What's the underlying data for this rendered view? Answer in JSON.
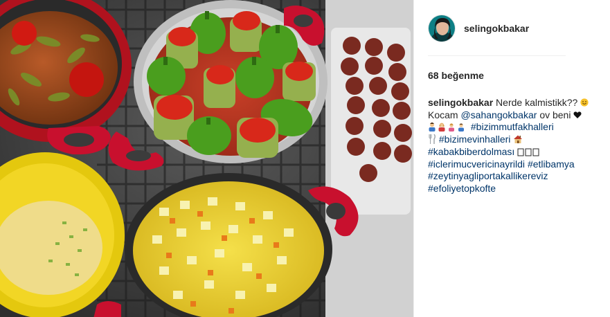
{
  "post": {
    "username": "selingokbakar",
    "likes_text": "68 beğenme"
  },
  "caption": {
    "username": "selingokbakar",
    "line1_text": "Nerde kalmistikk??",
    "line2_prefix": "Kocam",
    "mention": "@sahangokbakar",
    "line2_suffix": "ov beni",
    "hashtags": {
      "bizimmutfakhalleri": "#bizimmutfakhalleri",
      "bizimevinhalleri": "#bizimevinhalleri",
      "kabakbiberdolmasi": "#kabakbiberdolması",
      "iclerimucvericinayrildi": "#iclerimucvericinayrildi",
      "etlibamya": "#etlibamya",
      "zeytinyagliportakallikereviz": "#zeytinyagliportakallikereviz",
      "efoliyetopkofte": "#efoliyetopkofte"
    }
  },
  "icons": {
    "avatar": "profile-photo",
    "smile": "smiling-face-emoji",
    "heart": "black-heart-emoji",
    "family": "family-emoji",
    "utensils": "fork-and-knife-emoji",
    "house": "house-emoji",
    "boxes": "unsupported-glyph-boxes"
  },
  "colors": {
    "text": "#262626",
    "link": "#003569",
    "divider": "#efefef"
  }
}
